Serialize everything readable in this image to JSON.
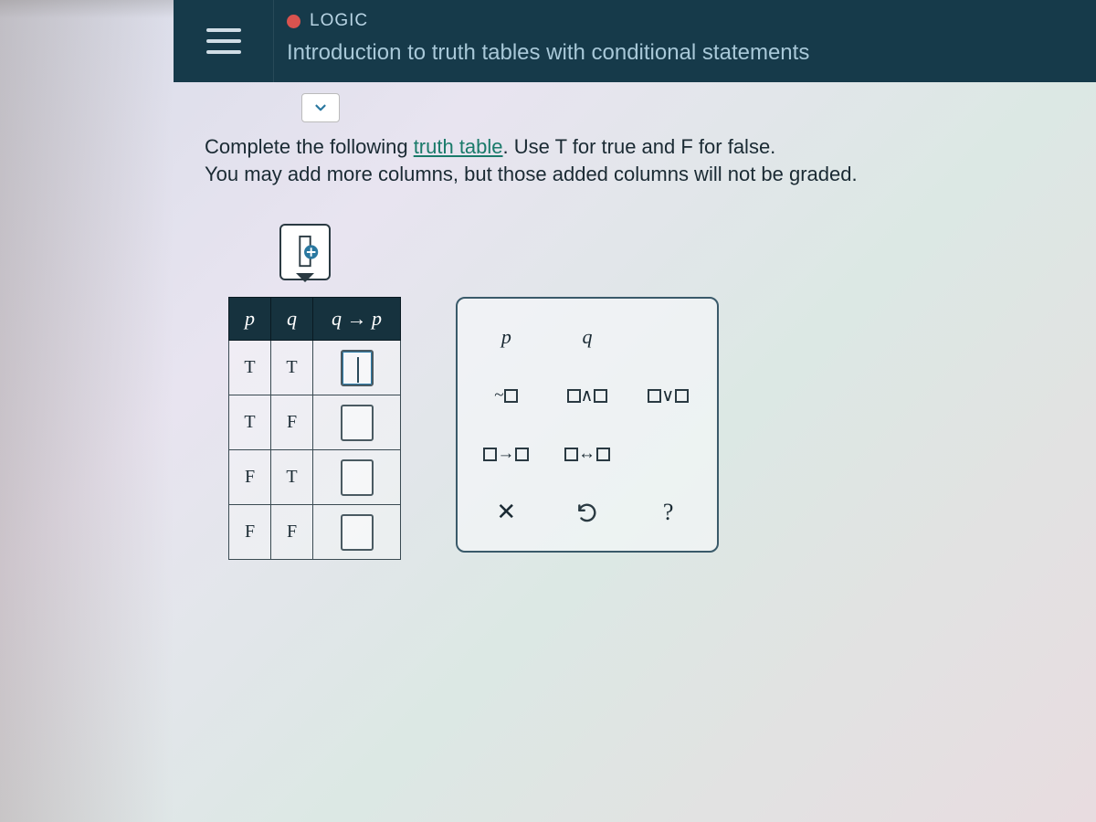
{
  "header": {
    "category": "LOGIC",
    "title": "Introduction to truth tables with conditional statements"
  },
  "instructions": {
    "line1_a": "Complete the following ",
    "link": "truth table",
    "line1_b": ". Use T for true and F for false.",
    "line2": "You may add more columns, but those added columns will not be graded."
  },
  "truth_table": {
    "headers": {
      "p": "p",
      "q": "q",
      "expr": "q → p"
    },
    "rows": [
      {
        "p": "T",
        "q": "T",
        "answer": "",
        "active": true
      },
      {
        "p": "T",
        "q": "F",
        "answer": "",
        "active": false
      },
      {
        "p": "F",
        "q": "T",
        "answer": "",
        "active": false
      },
      {
        "p": "F",
        "q": "F",
        "answer": "",
        "active": false
      }
    ]
  },
  "palette": {
    "var_p": "p",
    "var_q": "q",
    "not": "~",
    "and": "∧",
    "or": "∨",
    "implies": "→",
    "iff": "↔",
    "clear": "✕",
    "undo": "↶",
    "help": "?"
  }
}
